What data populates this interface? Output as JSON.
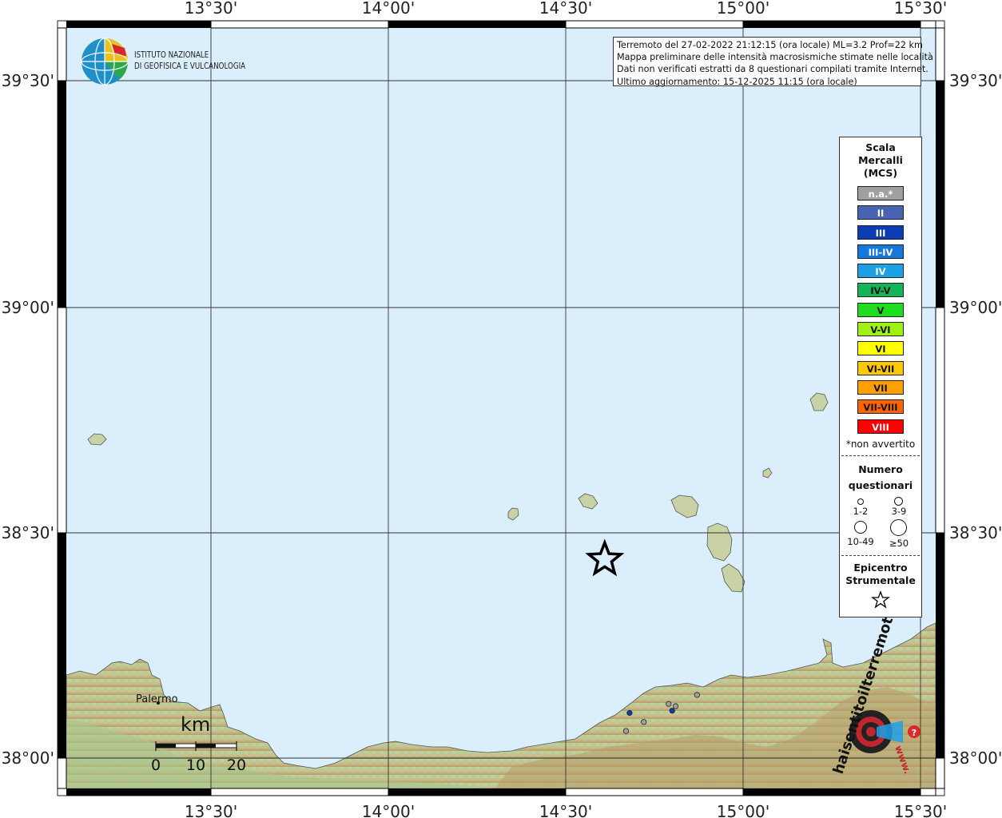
{
  "institute": {
    "line1": "ISTITUTO NAZIONALE",
    "line2": "DI GEOFISICA E VULCANOLOGIA"
  },
  "info": {
    "line1": "Terremoto del 27-02-2022 21:12:15 (ora locale) ML=3.2 Prof=22 km",
    "line2": "Mappa preliminare delle intensità macrosismiche stimate nelle località",
    "line3": "Dati non verificati estratti da 8 questionari compilati tramite Internet.",
    "line4": "Ultimo aggiornamento: 15-12-2025 11:15 (ora locale)"
  },
  "axes": {
    "lon_labels": [
      "13°30'",
      "14°00'",
      "14°30'",
      "15°00'",
      "15°30'"
    ],
    "lat_labels": [
      "39°30'",
      "39°00'",
      "38°30'",
      "38°00'"
    ]
  },
  "legend": {
    "title_lines": [
      "Scala",
      "Mercalli",
      "(MCS)"
    ],
    "scale": [
      {
        "label": "n.a.*",
        "color": "#a0a0a0",
        "text_color": "#ffffff"
      },
      {
        "label": "II",
        "color": "#4a64b4",
        "text_color": "#ffffff"
      },
      {
        "label": "III",
        "color": "#0a3cb4",
        "text_color": "#ffffff"
      },
      {
        "label": "III-IV",
        "color": "#1478dc",
        "text_color": "#ffffff"
      },
      {
        "label": "IV",
        "color": "#1ea0e6",
        "text_color": "#ffffff"
      },
      {
        "label": "IV-V",
        "color": "#14b45a",
        "text_color": "#111111"
      },
      {
        "label": "V",
        "color": "#1edc1e",
        "text_color": "#111111"
      },
      {
        "label": "V-VI",
        "color": "#a0f014",
        "text_color": "#111111"
      },
      {
        "label": "VI",
        "color": "#ffff00",
        "text_color": "#111111"
      },
      {
        "label": "VI-VII",
        "color": "#ffc800",
        "text_color": "#111111"
      },
      {
        "label": "VII",
        "color": "#ffa000",
        "text_color": "#111111"
      },
      {
        "label": "VII-VIII",
        "color": "#ff6400",
        "text_color": "#111111"
      },
      {
        "label": "VIII",
        "color": "#ff0000",
        "text_color": "#ffffff"
      }
    ],
    "note": "*non avvertito",
    "count_title_lines": [
      "Numero",
      "questionari"
    ],
    "count_labels": [
      "1-2",
      "3-9",
      "10-49",
      "≥50"
    ],
    "epicenter_lines": [
      "Epicentro",
      "Strumentale"
    ]
  },
  "map": {
    "place_label": "Palermo",
    "scale_unit": "km",
    "scale_ticks": [
      "0",
      "10",
      "20"
    ],
    "epicenter": {
      "lon": 14.61,
      "lat": 38.44
    },
    "observations": [
      {
        "lon": 14.68,
        "lat": 38.1,
        "color": "#0a3cb4"
      },
      {
        "lon": 14.72,
        "lat": 38.08,
        "color": "#a0a0a0"
      },
      {
        "lon": 14.67,
        "lat": 38.06,
        "color": "#a0a0a0"
      },
      {
        "lon": 14.79,
        "lat": 38.12,
        "color": "#a0a0a0"
      },
      {
        "lon": 14.8,
        "lat": 38.105,
        "color": "#0a3cb4"
      },
      {
        "lon": 14.81,
        "lat": 38.115,
        "color": "#a0a0a0"
      },
      {
        "lon": 14.87,
        "lat": 38.14,
        "color": "#a0a0a0"
      }
    ],
    "colors": {
      "sea": "#dbeefb",
      "land": "#b4cf94",
      "hills": "#cdbd8a",
      "mountains": "#b89c68"
    }
  },
  "watermark": {
    "text": "haisentitoilterremoto.it",
    "url": "www."
  }
}
